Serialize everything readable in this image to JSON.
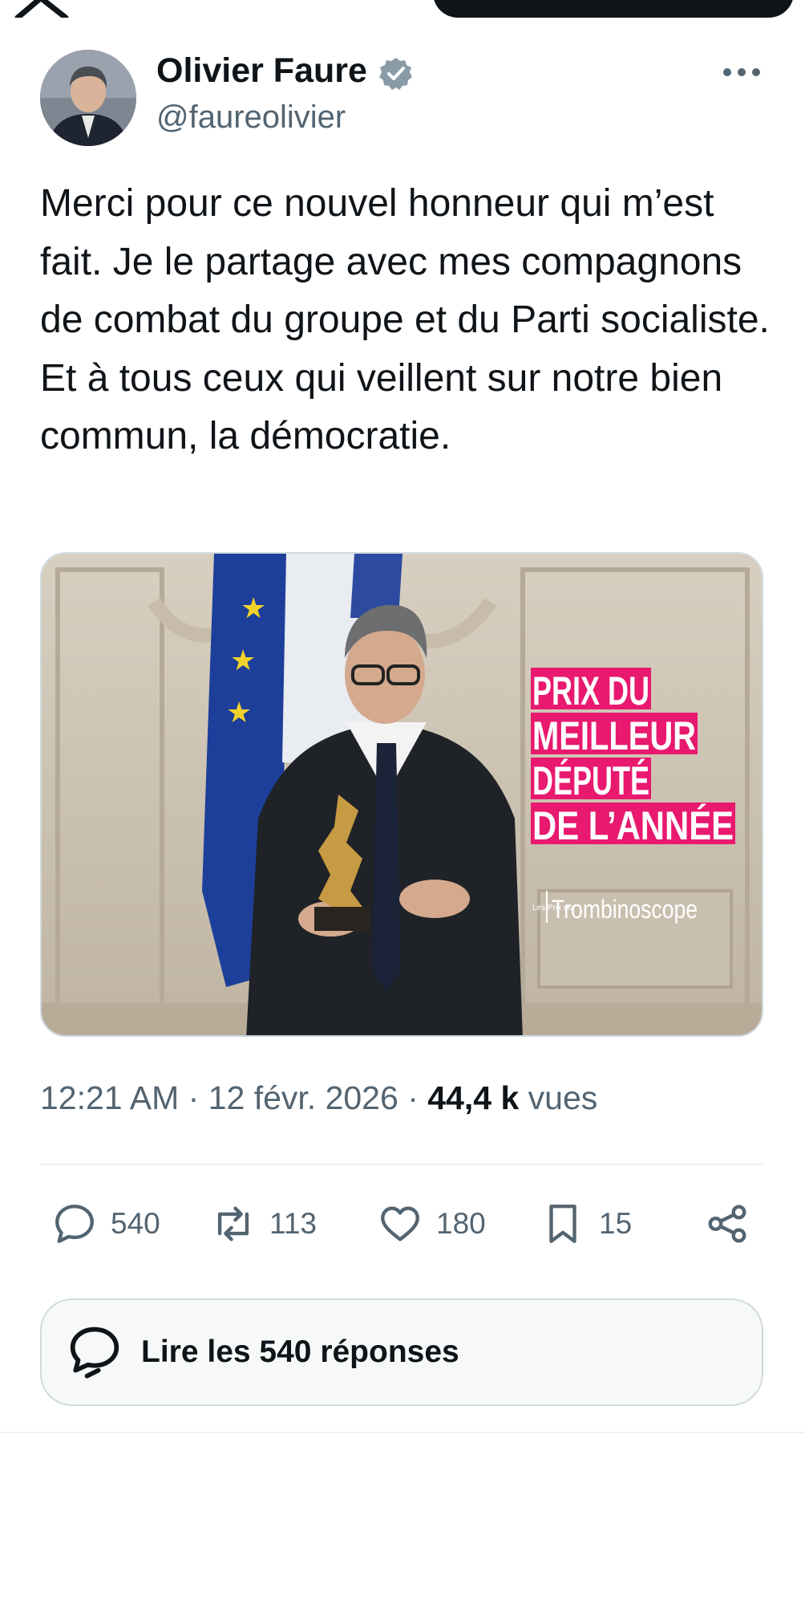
{
  "author": {
    "name": "Olivier Faure",
    "handle": "@faureolivier"
  },
  "tweet": {
    "text": "Merci pour ce nouvel honneur qui m’est fait. Je le partage avec mes compagnons de combat du groupe et du Parti socialiste. Et à tous ceux qui veillent sur notre bien commun, la démocratie."
  },
  "media": {
    "overlay_lines": [
      "PRIX DU",
      "MEILLEUR",
      "DÉPUTÉ",
      "DE L’ANNÉE"
    ],
    "brand_small": "Les Prix du",
    "brand": "Trombinoscope"
  },
  "meta": {
    "time": "12:21 AM",
    "separator": "·",
    "date": "12 févr. 2026",
    "views_count": "44,4 k",
    "views_label": "vues"
  },
  "actions": {
    "replies": "540",
    "retweets": "113",
    "likes": "180",
    "bookmarks": "15"
  },
  "read_replies": {
    "label": "Lire les 540 réponses"
  },
  "icons": {
    "logo": "x-logo-icon",
    "verified": "verified-badge-icon",
    "more": "more-icon",
    "reply": "reply-icon",
    "retweet": "retweet-icon",
    "like": "heart-icon",
    "bookmark": "bookmark-icon",
    "share": "share-icon",
    "replies": "replies-bubble-icon"
  },
  "colors": {
    "verified": "#8a9ba8",
    "secondary_text": "#536471",
    "overlay_pink": "#e8196f"
  }
}
